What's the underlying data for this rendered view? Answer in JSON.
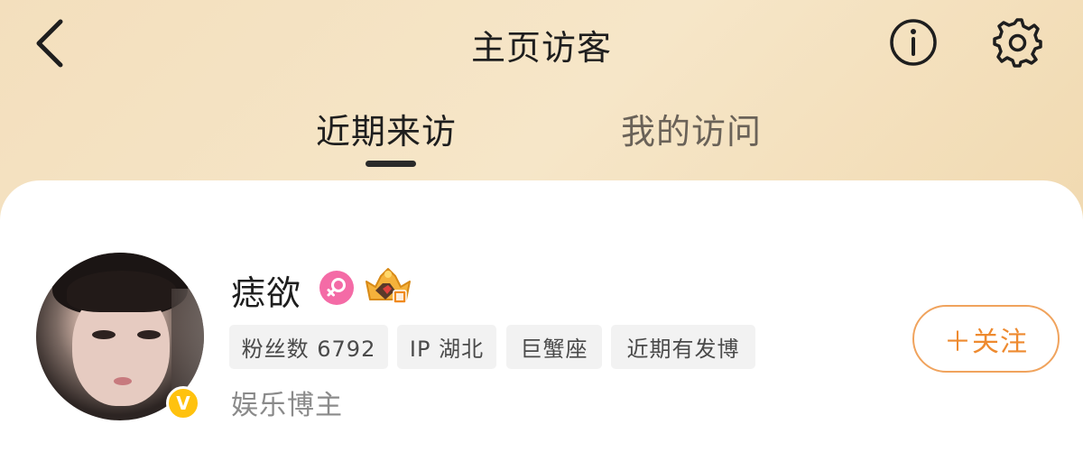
{
  "header": {
    "title": "主页访客",
    "back_icon": "chevron-left-icon",
    "info_icon": "info-icon",
    "settings_icon": "gear-icon"
  },
  "tabs": [
    {
      "label": "近期来访",
      "active": true
    },
    {
      "label": "我的访问",
      "active": false
    }
  ],
  "visitor": {
    "name": "痣欲",
    "gender_icon": "female-icon",
    "vip_icon": "crown-level-5-icon",
    "verified_icon": "v-verified-icon",
    "verified_badge_text": "V",
    "tags": [
      "粉丝数 6792",
      "IP 湖北",
      "巨蟹座",
      "近期有发博"
    ],
    "description": "娱乐博主",
    "follow_label": "＋关注"
  },
  "colors": {
    "accent": "#ee8a2f",
    "gender": "#f46ba6",
    "verify": "#ffc20e"
  }
}
